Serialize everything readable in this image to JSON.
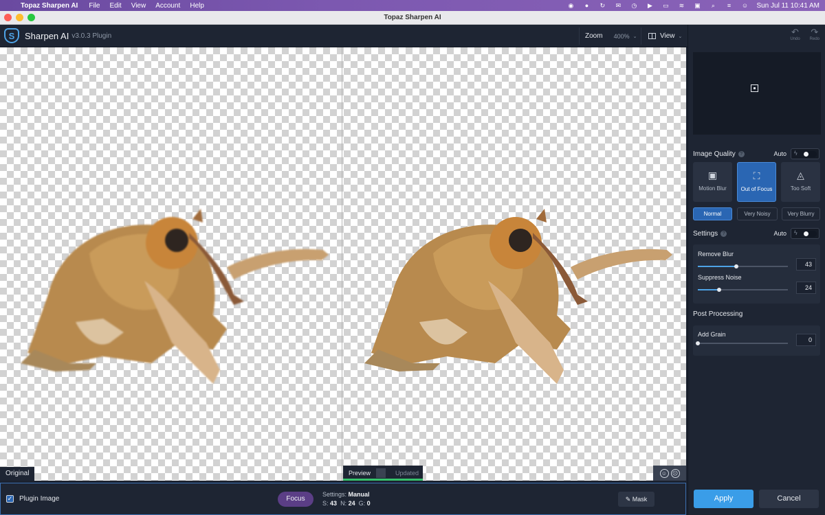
{
  "menubar": {
    "app_name": "Topaz Sharpen AI",
    "menus": [
      "File",
      "Edit",
      "View",
      "Account",
      "Help"
    ],
    "clock": "Sun Jul 11  10:41 AM"
  },
  "window": {
    "title": "Topaz Sharpen AI"
  },
  "header": {
    "app_title": "Sharpen AI",
    "version": "v3.0.3 Plugin",
    "zoom_label": "Zoom",
    "zoom_value": "400%",
    "view_label": "View"
  },
  "history": {
    "undo_label": "Undo",
    "redo_label": "Redo"
  },
  "canvas": {
    "original_label": "Original",
    "preview_label": "Preview",
    "updated_label": "Updated"
  },
  "bottom_bar": {
    "plugin_image_label": "Plugin Image",
    "plugin_image_checked": true,
    "focus_label": "Focus",
    "settings_prefix": "Settings:",
    "settings_mode": "Manual",
    "s_label": "S:",
    "s_value": "43",
    "n_label": "N:",
    "n_value": "24",
    "g_label": "G:",
    "g_value": "0",
    "mask_label": "Mask"
  },
  "image_quality": {
    "title": "Image Quality",
    "auto_label": "Auto",
    "modes": [
      {
        "label": "Motion Blur",
        "icon": "camera-shake-icon",
        "active": false
      },
      {
        "label": "Out of Focus",
        "icon": "focus-person-icon",
        "active": true
      },
      {
        "label": "Too Soft",
        "icon": "triangle-soft-icon",
        "active": false
      }
    ],
    "levels": [
      {
        "label": "Normal",
        "active": true
      },
      {
        "label": "Very Noisy",
        "active": false
      },
      {
        "label": "Very Blurry",
        "active": false
      }
    ]
  },
  "settings": {
    "title": "Settings",
    "auto_label": "Auto",
    "remove_blur": {
      "label": "Remove Blur",
      "value": "43",
      "fraction": 0.43
    },
    "suppress_noise": {
      "label": "Suppress Noise",
      "value": "24",
      "fraction": 0.24
    }
  },
  "post_processing": {
    "title": "Post Processing",
    "add_grain": {
      "label": "Add Grain",
      "value": "0",
      "fraction": 0.0
    }
  },
  "actions": {
    "apply_label": "Apply",
    "cancel_label": "Cancel"
  },
  "colors": {
    "accent": "#3a9de8",
    "active_mode": "#2a66b3",
    "focus_button": "#5b3e86",
    "preview_bar": "#36c26b"
  }
}
